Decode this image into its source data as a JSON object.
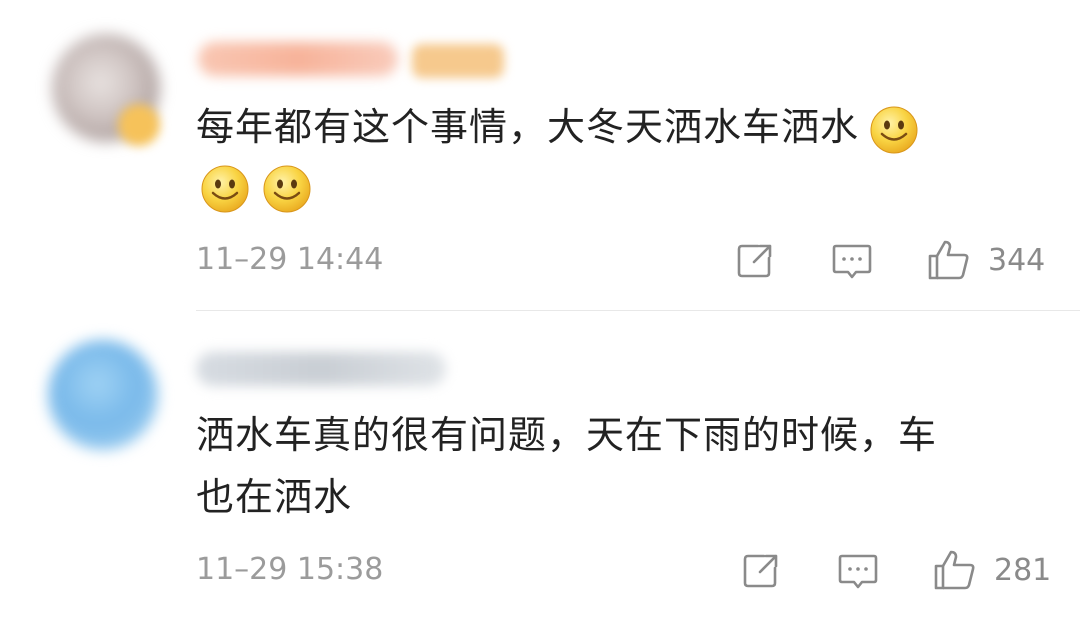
{
  "comments": [
    {
      "text": "每年都有这个事情，大冬天洒水车洒水",
      "timestamp": "11–29 14:44",
      "like_count": "344",
      "emojis_inline": [
        "smile-emoji"
      ],
      "emojis_row": [
        "smile-emoji",
        "smile-emoji"
      ]
    },
    {
      "text_line1": "洒水车真的很有问题，天在下雨的时候，车",
      "text_line2": "也在洒水",
      "timestamp": "11–29 15:38",
      "like_count": "281"
    }
  ],
  "icons": {
    "share": "share-icon",
    "comment": "comment-icon",
    "like": "thumbs-up-icon"
  },
  "colors": {
    "text": "#222222",
    "meta": "#9b9b9b",
    "icon": "#8a8a8a",
    "emoji_face": "#f7c933"
  }
}
